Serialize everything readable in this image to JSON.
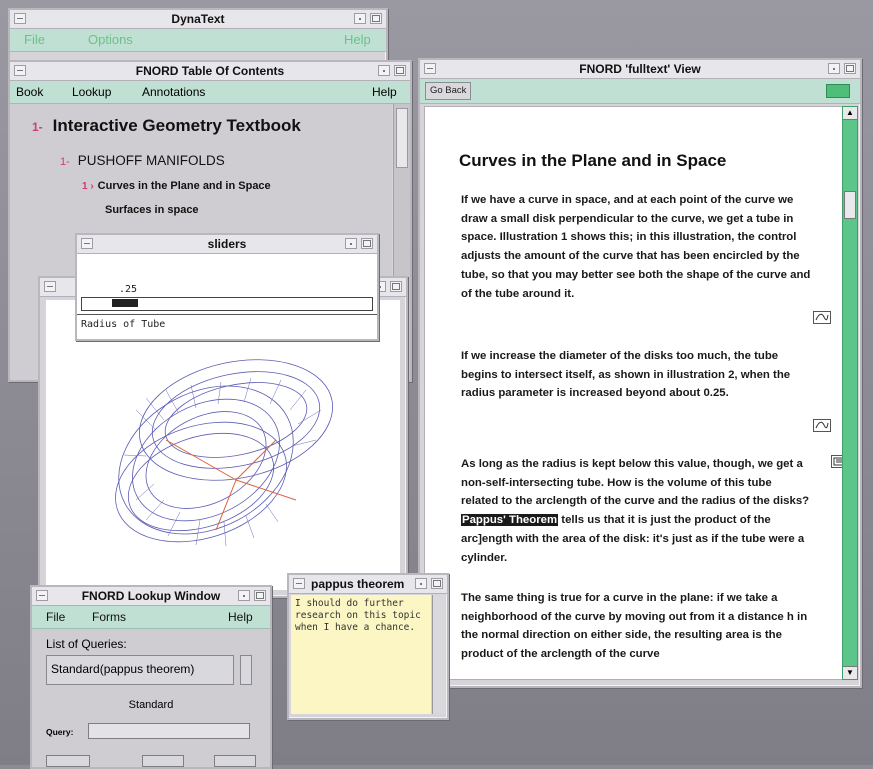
{
  "dynatext": {
    "title": "DynaText",
    "menu": {
      "file": "File",
      "options": "Options",
      "help": "Help"
    }
  },
  "toc": {
    "title": "FNORD Table Of Contents",
    "menu": {
      "book": "Book",
      "lookup": "Lookup",
      "annotations": "Annotations",
      "help": "Help"
    },
    "items": [
      {
        "marker": "1-",
        "label": "Interactive Geometry Textbook"
      },
      {
        "marker": "1-",
        "label": "PUSHOFF MANIFOLDS"
      },
      {
        "marker": "1 ›",
        "label": "Curves in the Plane and in Space"
      },
      {
        "marker": "",
        "label": "Surfaces in space"
      }
    ]
  },
  "fulltext": {
    "title": "FNORD 'fulltext' View",
    "go_back": "Go Back",
    "heading": "Curves in the Plane and in Space",
    "p1": "If we have a curve in space, and at each point of the curve we draw a small disk perpendicular to the curve, we get a tube in space. Illustration 1 shows this; in this illustration, the control adjusts the amount of the curve that has been encircled by the tube, so that you may better see both the shape of the curve and of the tube around it.",
    "p2": "If we increase the diameter of the disks too much, the tube begins to intersect itself, as shown in illustration 2, when the radius parameter is increased beyond about 0.25.",
    "p3_a": "As long as the radius is kept below this value, though, we get a non-self-intersecting tube. How is the volume of this tube related to the arclength of the curve and the radius of the disks?",
    "p3_hl": "Pappus' Theorem",
    "p3_b": "tells us that it is just the product of the arc]ength with the area of the disk: it's just as if the tube were a cylinder.",
    "p4": "The same thing is true for a curve in the plane: if we take a neighborhood of the curve by moving out from it a distance h in the normal direction on either side, the resulting area is the product of the arclength of the curve"
  },
  "sliders": {
    "title": "sliders",
    "value": ".25",
    "label": "Radius of Tube",
    "level": 0.25
  },
  "lookup": {
    "title": "FNORD Lookup Window",
    "menu": {
      "file": "File",
      "forms": "Forms",
      "help": "Help"
    },
    "list_label": "List of Queries:",
    "query_item": "Standard(pappus theorem)",
    "form_name": "Standard",
    "query_label": "Query:"
  },
  "note": {
    "title": "pappus theorem",
    "text": "I should do further research on this topic when I have a chance."
  },
  "colors": {
    "menubar": "#bfe0d3",
    "toc_marker": "#d23b6c",
    "scroll": "#5cc58a",
    "note": "#fbf6c4"
  }
}
